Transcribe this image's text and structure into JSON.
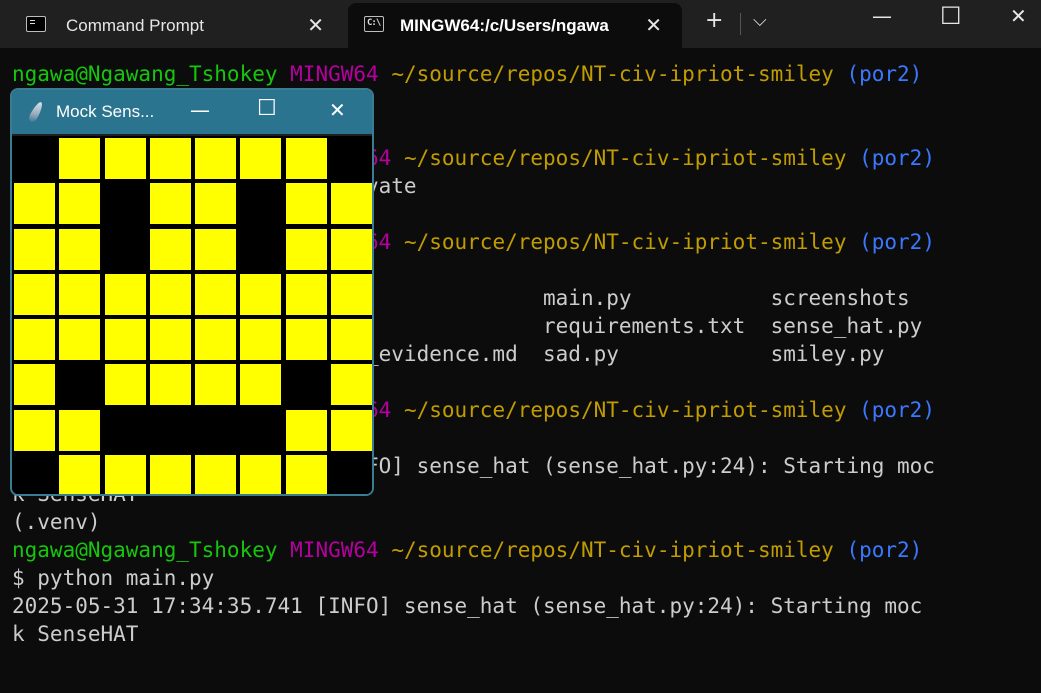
{
  "tabs": [
    {
      "title": "Command Prompt",
      "icon": "cmd-icon",
      "active": false
    },
    {
      "title": "MINGW64:/c/Users/ngawa",
      "icon": "terminal-icon",
      "active": true
    }
  ],
  "tabbar": {
    "new_tab": "+",
    "dropdown": "⌵"
  },
  "window_controls": {
    "minimize": "—",
    "maximize": "☐",
    "close": "✕"
  },
  "terminal": {
    "lines": [
      [
        {
          "t": "ngawa@Ngawang_Tshokey ",
          "c": "green"
        },
        {
          "t": "MINGW64 ",
          "c": "purple"
        },
        {
          "t": "~/source/repos/NT-civ-ipriot-smiley ",
          "c": "yellow"
        },
        {
          "t": "(por2)",
          "c": "cyan"
        }
      ],
      [],
      [],
      [
        {
          "t": "                           ",
          "c": "white"
        },
        {
          "t": "W64 ",
          "c": "purple"
        },
        {
          "t": "~/source/repos/NT-civ-ipriot-smiley ",
          "c": "yellow"
        },
        {
          "t": "(por2)",
          "c": "cyan"
        }
      ],
      [
        {
          "t": "                           ivate",
          "c": "white"
        }
      ],
      [],
      [
        {
          "t": "                           ",
          "c": "white"
        },
        {
          "t": "W64 ",
          "c": "purple"
        },
        {
          "t": "~/source/repos/NT-civ-ipriot-smiley ",
          "c": "yellow"
        },
        {
          "t": "(por2)",
          "c": "cyan"
        }
      ],
      [],
      [
        {
          "t": "                                          main.py           screenshots",
          "c": "white"
        }
      ],
      [
        {
          "t": "                                          requirements.txt  sense_hat.py",
          "c": "white"
        }
      ],
      [
        {
          "t": "                           d_evidence.md  sad.py            smiley.py",
          "c": "white"
        }
      ],
      [],
      [
        {
          "t": "                           ",
          "c": "white"
        },
        {
          "t": "W64 ",
          "c": "purple"
        },
        {
          "t": "~/source/repos/NT-civ-ipriot-smiley ",
          "c": "yellow"
        },
        {
          "t": "(por2)",
          "c": "cyan"
        }
      ],
      [],
      [
        {
          "t": "                           NFO] sense_hat (sense_hat.py:24): Starting moc",
          "c": "white"
        }
      ],
      [
        {
          "t": "k SenseHAT",
          "c": "white"
        }
      ],
      [
        {
          "t": "(.venv)",
          "c": "white"
        }
      ],
      [
        {
          "t": "ngawa@Ngawang_Tshokey ",
          "c": "green"
        },
        {
          "t": "MINGW64 ",
          "c": "purple"
        },
        {
          "t": "~/source/repos/NT-civ-ipriot-smiley ",
          "c": "yellow"
        },
        {
          "t": "(por2)",
          "c": "cyan"
        }
      ],
      [
        {
          "t": "$ python main.py",
          "c": "white"
        }
      ],
      [
        {
          "t": "2025-05-31 17:34:35.741 [INFO] sense_hat (sense_hat.py:24): Starting moc",
          "c": "white"
        }
      ],
      [
        {
          "t": "k SenseHAT",
          "c": "white"
        }
      ]
    ]
  },
  "mock_window": {
    "title": "Mock Sens...",
    "controls": {
      "minimize": "—",
      "maximize": "☐",
      "close": "✕"
    },
    "colors": {
      "on": "#ffff00",
      "off": "#000000"
    },
    "pixels": [
      [
        0,
        1,
        1,
        1,
        1,
        1,
        1,
        0
      ],
      [
        1,
        1,
        0,
        1,
        1,
        0,
        1,
        1
      ],
      [
        1,
        1,
        0,
        1,
        1,
        0,
        1,
        1
      ],
      [
        1,
        1,
        1,
        1,
        1,
        1,
        1,
        1
      ],
      [
        1,
        1,
        1,
        1,
        1,
        1,
        1,
        1
      ],
      [
        1,
        0,
        1,
        1,
        1,
        1,
        0,
        1
      ],
      [
        1,
        1,
        0,
        0,
        0,
        0,
        1,
        1
      ],
      [
        0,
        1,
        1,
        1,
        1,
        1,
        1,
        0
      ]
    ]
  }
}
